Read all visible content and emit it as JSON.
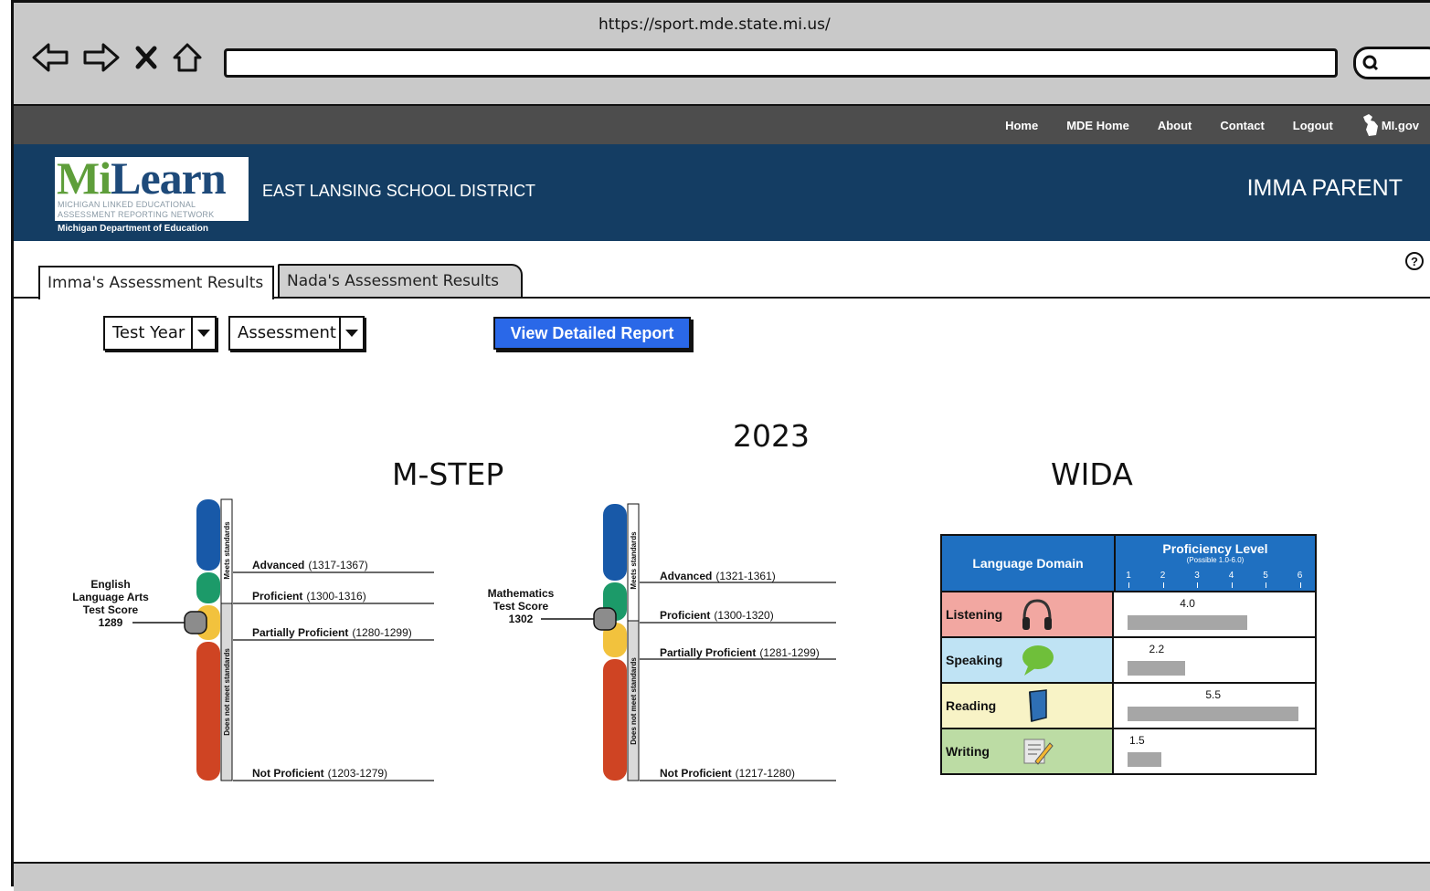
{
  "browser": {
    "url": "https://sport.mde.state.mi.us/"
  },
  "topnav": {
    "links": [
      "Home",
      "MDE Home",
      "About",
      "Contact",
      "Logout"
    ],
    "mi_gov": "MI.gov"
  },
  "banner": {
    "logo_text_m": "Mi",
    "logo_text_rest": "Learn",
    "logo_line1": "MICHIGAN LINKED EDUCATIONAL",
    "logo_line2": "ASSESSMENT REPORTING NETWORK",
    "logo_line3": "Michigan Department of Education",
    "district": "EAST LANSING SCHOOL DISTRICT",
    "user": "IMMA PARENT"
  },
  "tabs": [
    {
      "label": "Imma's Assessment Results",
      "active": true
    },
    {
      "label": "Nada's Assessment Results",
      "active": false
    }
  ],
  "filters": {
    "test_year": "Test Year",
    "assessment": "Assessment",
    "report_button": "View Detailed Report"
  },
  "main": {
    "year": "2023",
    "mstep_title": "M-STEP",
    "wida_title": "WIDA"
  },
  "mstep": {
    "side_top": "Meets standards",
    "side_bottom": "Does not meet standards",
    "ela": {
      "score_lines": [
        "English",
        "Language Arts",
        "Test Score",
        "1289"
      ],
      "score": 1289,
      "levels": [
        {
          "name": "Advanced",
          "range": "(1317-1367)"
        },
        {
          "name": "Proficient",
          "range": "(1300-1316)"
        },
        {
          "name": "Partially Proficient",
          "range": "(1280-1299)"
        },
        {
          "name": "Not Proficient",
          "range": "(1203-1279)"
        }
      ]
    },
    "math": {
      "score_lines": [
        "Mathematics",
        "Test Score",
        "1302"
      ],
      "score": 1302,
      "levels": [
        {
          "name": "Advanced",
          "range": "(1321-1361)"
        },
        {
          "name": "Proficient",
          "range": "(1300-1320)"
        },
        {
          "name": "Partially Proficient",
          "range": "(1281-1299)"
        },
        {
          "name": "Not Proficient",
          "range": "(1217-1280)"
        }
      ]
    },
    "colors": {
      "advanced": "#1859a8",
      "proficient": "#1c9a69",
      "partial": "#f2c23d",
      "not": "#cf4423"
    }
  },
  "wida": {
    "col1": "Language Domain",
    "col2": "Proficiency Level",
    "col2_sub": "(Possible 1.0-6.0)",
    "scale": [
      "1",
      "2",
      "3",
      "4",
      "5",
      "6"
    ],
    "rows": [
      {
        "domain": "Listening",
        "score": 4.0,
        "score_label": "4.0",
        "color": "#f2a7a1",
        "icon": "headphones-icon"
      },
      {
        "domain": "Speaking",
        "score": 2.2,
        "score_label": "2.2",
        "color": "#bfe3f4",
        "icon": "speech-bubble-icon"
      },
      {
        "domain": "Reading",
        "score": 5.5,
        "score_label": "5.5",
        "color": "#f8f3c6",
        "icon": "book-icon"
      },
      {
        "domain": "Writing",
        "score": 1.5,
        "score_label": "1.5",
        "color": "#bcdca4",
        "icon": "pencil-paper-icon"
      }
    ]
  }
}
